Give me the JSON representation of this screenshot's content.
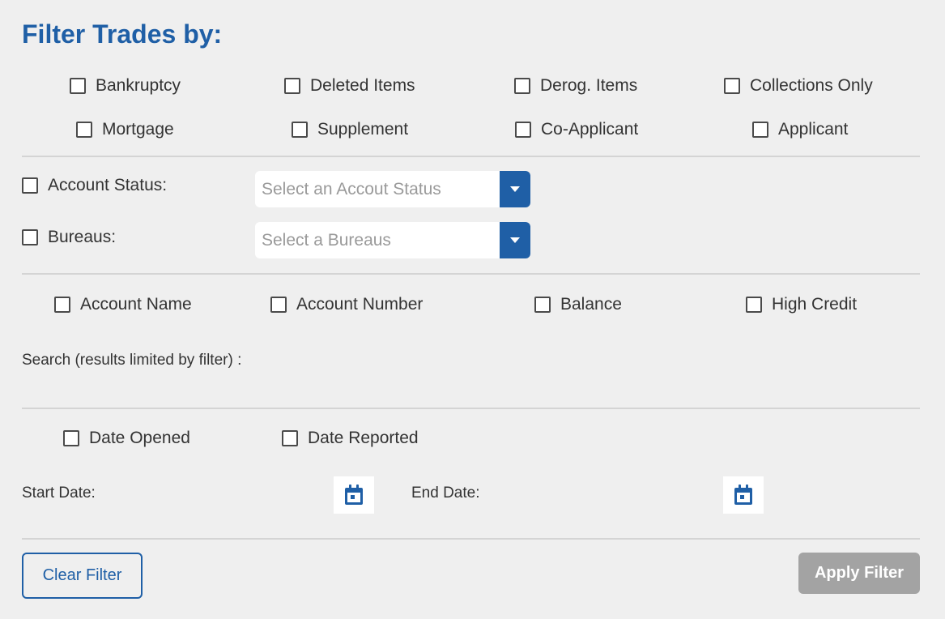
{
  "title": "Filter Trades by:",
  "filters_row1": [
    "Bankruptcy",
    "Deleted Items",
    "Derog. Items",
    "Collections Only"
  ],
  "filters_row2": [
    "Mortgage",
    "Supplement",
    "Co-Applicant",
    "Applicant"
  ],
  "account_status": {
    "label": "Account Status:",
    "placeholder": "Select an Accout Status"
  },
  "bureaus": {
    "label": "Bureaus:",
    "placeholder": "Select a Bureaus"
  },
  "search_fields": [
    "Account Name",
    "Account Number",
    "Balance",
    "High Credit"
  ],
  "search_label": "Search (results limited by filter) :",
  "date_types": [
    "Date Opened",
    "Date Reported"
  ],
  "start_date_label": "Start Date:",
  "end_date_label": "End Date:",
  "clear_label": "Clear Filter",
  "apply_label": "Apply Filter",
  "icons": {
    "calendar": "calendar-icon",
    "dropdown": "chevron-down-icon"
  },
  "colors": {
    "accent": "#1f5fa6",
    "disabled": "#a3a3a3"
  }
}
